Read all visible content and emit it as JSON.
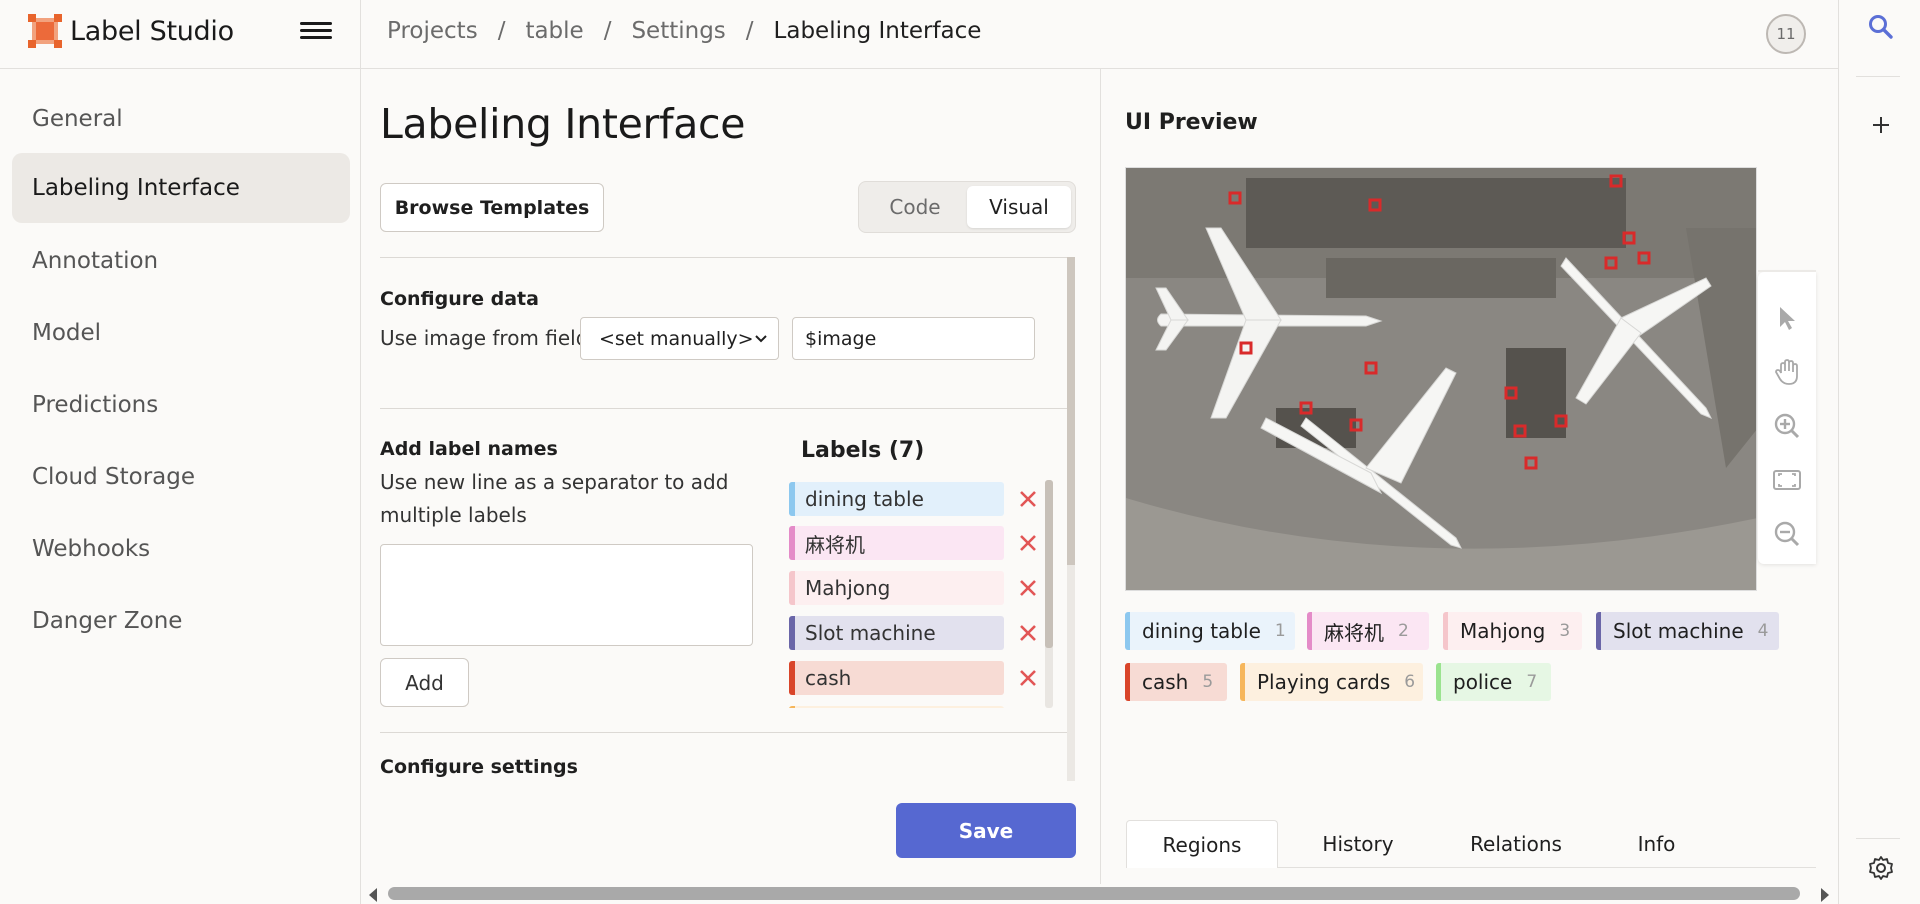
{
  "app": {
    "name": "Label Studio"
  },
  "breadcrumb": {
    "items": [
      "Projects",
      "table",
      "Settings"
    ],
    "separator": "/",
    "current": "Labeling Interface"
  },
  "user": {
    "avatar_text": "11"
  },
  "sidebar": {
    "items": [
      {
        "label": "General",
        "active": false
      },
      {
        "label": "Labeling Interface",
        "active": true
      },
      {
        "label": "Annotation",
        "active": false
      },
      {
        "label": "Model",
        "active": false
      },
      {
        "label": "Predictions",
        "active": false
      },
      {
        "label": "Cloud Storage",
        "active": false
      },
      {
        "label": "Webhooks",
        "active": false
      },
      {
        "label": "Danger Zone",
        "active": false
      }
    ]
  },
  "main": {
    "title": "Labeling Interface",
    "browse_templates_label": "Browse Templates",
    "mode_tabs": [
      "Code",
      "Visual"
    ],
    "mode_selected": "Visual",
    "configure_data": {
      "title": "Configure data",
      "field_label": "Use image from field",
      "select_value": "<set manually>",
      "input_value": "$image"
    },
    "add_labels": {
      "title": "Add label names",
      "hint": "Use new line as a separator to add multiple labels",
      "textarea_value": "",
      "add_label": "Add"
    },
    "labels": {
      "title": "Labels (7)",
      "items": [
        {
          "name": "dining table",
          "bg": "#e2f0fb",
          "bar": "#8dc8ef"
        },
        {
          "name": "麻将机",
          "bg": "#fbe6f3",
          "bar": "#e48bc8"
        },
        {
          "name": "Mahjong",
          "bg": "#fdeff0",
          "bar": "#f5c6cb"
        },
        {
          "name": "Slot machine",
          "bg": "#e2e1ee",
          "bar": "#6a66a8"
        },
        {
          "name": "cash",
          "bg": "#f7dbd4",
          "bar": "#d9452a"
        }
      ]
    },
    "configure_settings": {
      "title": "Configure settings"
    },
    "save_label": "Save"
  },
  "preview": {
    "title": "UI Preview",
    "image_description_icon": "airport-aerial-image",
    "tools": [
      "pointer-icon",
      "hand-pan-icon",
      "zoom-in-icon",
      "zoom-fit-icon",
      "zoom-out-icon"
    ],
    "labels": [
      {
        "name": "dining table",
        "hotkey": "1",
        "bg": "#eaf3fb",
        "bar": "#8dc8ef"
      },
      {
        "name": "麻将机",
        "hotkey": "2",
        "bg": "#fbe6f3",
        "bar": "#e48bc8"
      },
      {
        "name": "Mahjong",
        "hotkey": "3",
        "bg": "#fdeff0",
        "bar": "#f5c6cb"
      },
      {
        "name": "Slot machine",
        "hotkey": "4",
        "bg": "#e2e1ee",
        "bar": "#6a66a8"
      },
      {
        "name": "cash",
        "hotkey": "5",
        "bg": "#f7dbd4",
        "bar": "#d9452a"
      },
      {
        "name": "Playing cards",
        "hotkey": "6",
        "bg": "#fdf0df",
        "bar": "#f6b65b"
      },
      {
        "name": "police",
        "hotkey": "7",
        "bg": "#e6f7e4",
        "bar": "#9be38f"
      }
    ],
    "tabs": [
      "Regions",
      "History",
      "Relations",
      "Info"
    ],
    "active_tab": "Regions"
  },
  "colors": {
    "accent": "#5668d1",
    "delete": "#e25555",
    "logo": "#e8642c"
  }
}
